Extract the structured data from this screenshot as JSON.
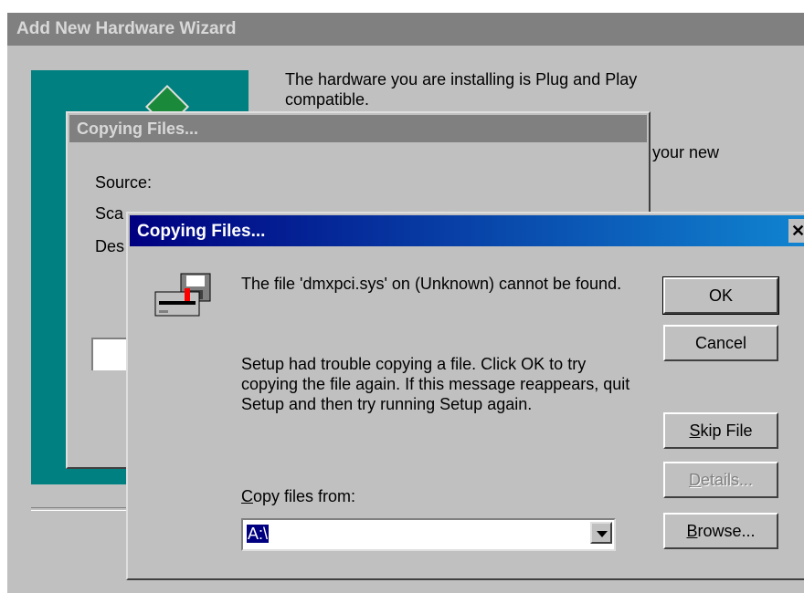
{
  "wizard": {
    "title": "Add New Hardware Wizard",
    "text_line1": "The hardware you are installing is Plug and Play",
    "text_line2": "compatible.",
    "text_fragment": "rt your new"
  },
  "copy_dialog_back": {
    "title": "Copying Files...",
    "source_label": "Source:",
    "scan_label": "Sca",
    "dest_label": "Des"
  },
  "error_dialog": {
    "title": "Copying Files...",
    "close_glyph": "✕",
    "message_line1": "The file 'dmxpci.sys' on (Unknown) cannot be found.",
    "message_line2": "Setup had trouble copying a file. Click OK to try copying the file again. If this message reappears, quit Setup and then try running Setup again.",
    "copy_from_label_underlined": "C",
    "copy_from_label_rest": "opy files from:",
    "copy_from_value": "A:\\",
    "icons": {
      "disk": "floppy-disk-drive-icon",
      "dropdown": "chevron-down-icon"
    },
    "buttons": {
      "ok": "OK",
      "cancel": "Cancel",
      "skip_underlined": "S",
      "skip_rest": "kip File",
      "details_underlined": "D",
      "details_rest": "etails...",
      "browse_underlined": "B",
      "browse_rest": "rowse..."
    },
    "colors": {
      "titlebar_start": "#000080",
      "titlebar_end": "#1084d0",
      "face": "#c0c0c0",
      "teal_panel": "#008080"
    }
  }
}
